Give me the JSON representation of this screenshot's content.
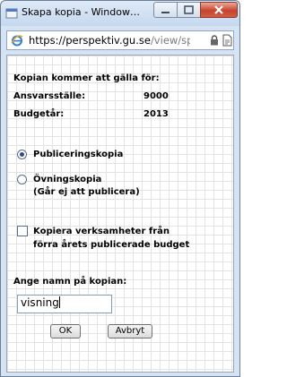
{
  "window": {
    "title": "Skapa kopia - Window…"
  },
  "address": {
    "url_main": "https://perspektiv.gu.se",
    "url_dim": "/view/spara…"
  },
  "form": {
    "heading": "Kopian kommer att gälla för:",
    "ansvar_label": "Ansvarsställe:",
    "ansvar_value": "9000",
    "budget_label": "Budgetår:",
    "budget_value": "2013",
    "radio_pub": "Publiceringskopia",
    "radio_ovn": "Övningskopia",
    "radio_ovn_note": "(Går ej att publicera)",
    "copy_line1": "Kopiera verksamheter från",
    "copy_line2": "förra årets publicerade budget",
    "name_label": "Ange namn på kopian:",
    "name_value": "visning",
    "ok": "OK",
    "cancel": "Avbryt",
    "selected_radio": "Publiceringskopia",
    "copy_checked": false
  }
}
